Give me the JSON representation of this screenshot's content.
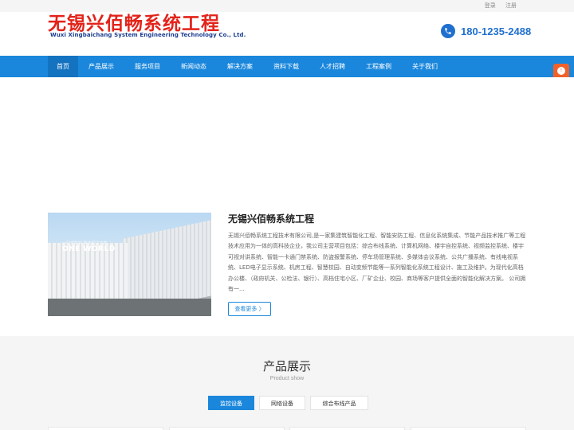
{
  "topbar": {
    "login": "登录",
    "register": "注册"
  },
  "header": {
    "logo_cn": "无锡兴佰畅系统工程",
    "logo_en": "Wuxi Xingbaichang System Engineering Technology Co., Ltd.",
    "phone": "180-1235-2488",
    "phone_icon": "phone-icon"
  },
  "nav": {
    "items": [
      {
        "label": "首页"
      },
      {
        "label": "产品展示"
      },
      {
        "label": "服务项目"
      },
      {
        "label": "新闻动态"
      },
      {
        "label": "解决方案"
      },
      {
        "label": "资料下载"
      },
      {
        "label": "人才招聘"
      },
      {
        "label": "工程案例"
      },
      {
        "label": "关于我们"
      }
    ],
    "active_index": 0
  },
  "float_consult": {
    "label": "在线咨询",
    "chars": [
      "在",
      "线",
      "咨",
      "询"
    ]
  },
  "about": {
    "image_small_text": "一站式防护 整体解决方案",
    "image_big_text": "ONE WORLD",
    "title": "无锡兴佰畅系统工程",
    "text": "无锡兴佰畅系统工程技术有限公司,是一家集建筑智能化工程、智能安防工程、信息化系统集成、节能产品技术推广等工程技术应用为一体的高科技企业，我公司主营项目包括：综合布线系统、计算机网络、楼宇自控系统、视频监控系统、楼宇可视对讲系统、智能一卡通门禁系统、防盗报警系统、停车场管理系统、多媒体会议系统、公共广播系统、有线电视系统、LED电子显示系统、机房工程、智慧校园、自动变频节能等一系列智能化系统工程设计、施工及维护。为现代化高档办公楼、（政府机关、公检法、银行）、高档住宅小区、厂矿企业、校园、商场等客户提供全面的智能化解决方案。 公司拥有一...",
    "more_label": "查看更多 〉"
  },
  "products": {
    "title": "产品展示",
    "subtitle": "Product show",
    "tabs": [
      {
        "label": "监控设备"
      },
      {
        "label": "网络设备"
      },
      {
        "label": "综合布线产品"
      }
    ],
    "active_tab": 0
  },
  "colors": {
    "brand_blue": "#1a87dc",
    "logo_red": "#e2231a",
    "consult_orange": "#f0612b"
  }
}
